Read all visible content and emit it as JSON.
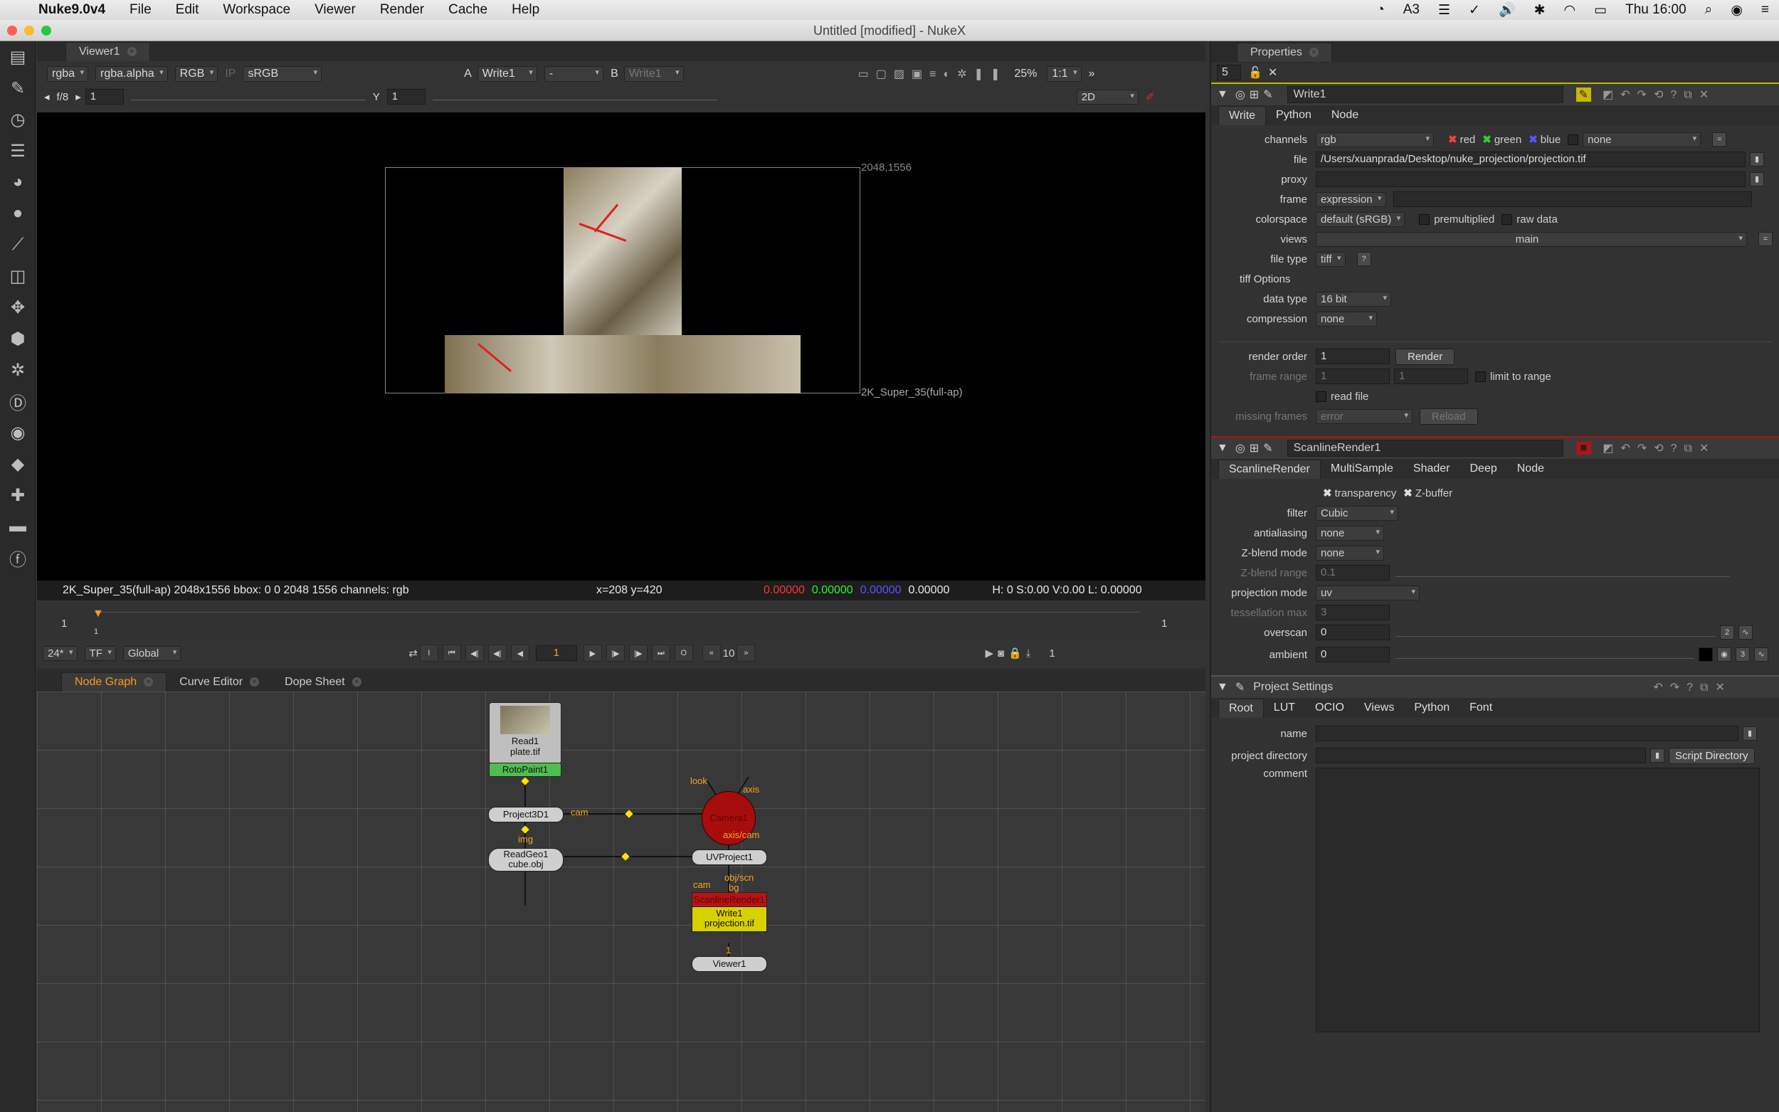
{
  "menubar": {
    "app": "Nuke9.0v4",
    "items": [
      "File",
      "Edit",
      "Workspace",
      "Viewer",
      "Render",
      "Cache",
      "Help"
    ],
    "status_right": {
      "badge": "3",
      "clock": "Thu 16:00"
    }
  },
  "window": {
    "title": "Untitled [modified] - NukeX"
  },
  "viewer": {
    "tab": "Viewer1",
    "toolbar1": {
      "channels": "rgba",
      "alpha": "rgba.alpha",
      "colorspace": "RGB",
      "ip": "IP",
      "lut": "sRGB",
      "a_label": "A",
      "a_input": "Write1",
      "mid": "-",
      "b_label": "B",
      "b_input": "Write1",
      "zoom": "25%",
      "ratio": "1:1"
    },
    "toolbar2": {
      "fstop": "f/8",
      "gain": "1",
      "y_label": "Y",
      "gamma": "1",
      "mode": "2D"
    },
    "format_corner": "2048,1556",
    "format_label": "2K_Super_35(full-ap)",
    "status": {
      "info": "2K_Super_35(full-ap) 2048x1556  bbox: 0 0 2048 1556 channels: rgb",
      "coords": "x=208 y=420",
      "r": "0.00000",
      "g": "0.00000",
      "b": "0.00000",
      "a": "0.00000",
      "hsv": "H:  0 S:0.00 V:0.00  L: 0.00000"
    }
  },
  "timeline": {
    "start": "1",
    "end": "1",
    "fps": "24*",
    "tf": "TF",
    "global": "Global",
    "current": "1",
    "step": "10",
    "end_frame": "1",
    "frame_marker": "1"
  },
  "nodegraph": {
    "tabs": [
      "Node Graph",
      "Curve Editor",
      "Dope Sheet"
    ],
    "nodes": {
      "read1": "Read1",
      "read1_file": "plate.tif",
      "roto": "RotoPaint1",
      "project3d": "Project3D1",
      "camera": "Camera1",
      "readgeo": "ReadGeo1",
      "readgeo_file": "cube.obj",
      "uvproject": "UVProject1",
      "scanline": "ScanlineRender1",
      "write": "Write1",
      "write_file": "projection.tif",
      "viewer": "Viewer1"
    },
    "labels": {
      "look": "look",
      "axis": "axis",
      "cam": "cam",
      "img": "img",
      "axiscam": "axis/cam",
      "objscn": "obj/scn",
      "bg": "bg",
      "cam2": "cam",
      "v1": "1"
    }
  },
  "properties": {
    "title": "Properties",
    "count": "5",
    "write": {
      "name": "Write1",
      "tabs": [
        "Write",
        "Python",
        "Node"
      ],
      "channels": "rgb",
      "red": "red",
      "green": "green",
      "blue": "blue",
      "none": "none",
      "file": "/Users/xuanprada/Desktop/nuke_projection/projection.tif",
      "frame": "expression",
      "colorspace": "default (sRGB)",
      "premultiplied": "premultiplied",
      "raw": "raw data",
      "views": "main",
      "filetype": "tiff",
      "help": "?",
      "tiff_options": "tiff Options",
      "datatype": "16 bit",
      "compression": "none",
      "render_order": "1",
      "render": "Render",
      "fr_a": "1",
      "fr_b": "1",
      "limit": "limit to range",
      "readfile": "read file",
      "missing": "error",
      "reload": "Reload",
      "labels": {
        "channels": "channels",
        "file": "file",
        "proxy": "proxy",
        "frame": "frame",
        "colorspace": "colorspace",
        "views": "views",
        "filetype": "file type",
        "datatype": "data type",
        "compression": "compression",
        "render_order": "render order",
        "frame_range": "frame range",
        "missing": "missing frames"
      }
    },
    "scanline": {
      "name": "ScanlineRender1",
      "tabs": [
        "ScanlineRender",
        "MultiSample",
        "Shader",
        "Deep",
        "Node"
      ],
      "transparency": "transparency",
      "zbuffer": "Z-buffer",
      "filter": "Cubic",
      "antialiasing": "none",
      "zblend": "none",
      "zrange": "0.1",
      "projection": "uv",
      "tess": "3",
      "overscan": "0",
      "ambient": "0",
      "ov_num": "2",
      "amb_num": "3",
      "labels": {
        "filter": "filter",
        "antialiasing": "antialiasing",
        "zblend": "Z-blend mode",
        "zrange": "Z-blend range",
        "projection": "projection mode",
        "tess": "tessellation max",
        "overscan": "overscan",
        "ambient": "ambient"
      }
    },
    "project": {
      "name": "Project Settings",
      "tabs": [
        "Root",
        "LUT",
        "OCIO",
        "Views",
        "Python",
        "Font"
      ],
      "scriptdir": "Script Directory",
      "labels": {
        "name": "name",
        "dir": "project directory",
        "comment": "comment"
      }
    }
  },
  "colors": {
    "accent": "#f39c22",
    "write_header": "#c8b800",
    "scanline_header": "#b01414",
    "camera": "#a80d0d"
  }
}
